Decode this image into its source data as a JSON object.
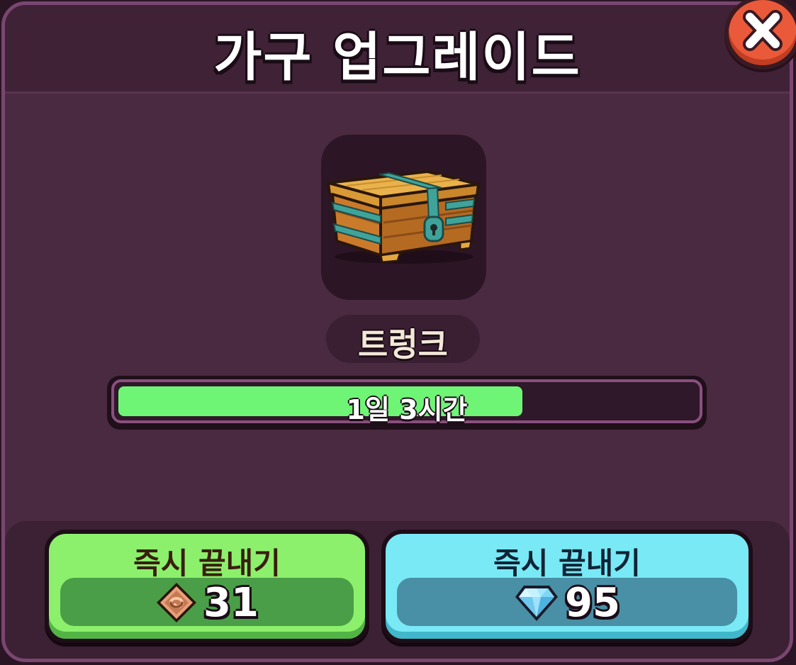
{
  "dialog": {
    "title": "가구 업그레이드"
  },
  "item": {
    "name": "트렁크",
    "icon": "treasure-chest-icon"
  },
  "progress": {
    "label": "1일 3시간",
    "fraction": 0.7
  },
  "actions": [
    {
      "label": "즉시 끝내기",
      "cost": "31",
      "currency_icon": "bronze-token-icon"
    },
    {
      "label": "즉시 끝내기",
      "cost": "95",
      "currency_icon": "diamond-icon"
    }
  ],
  "colors": {
    "progress_fill": "#6ff576",
    "green_button": "#8cf06c",
    "cyan_button": "#79e9f5",
    "close_button": "#ea5a3a"
  }
}
